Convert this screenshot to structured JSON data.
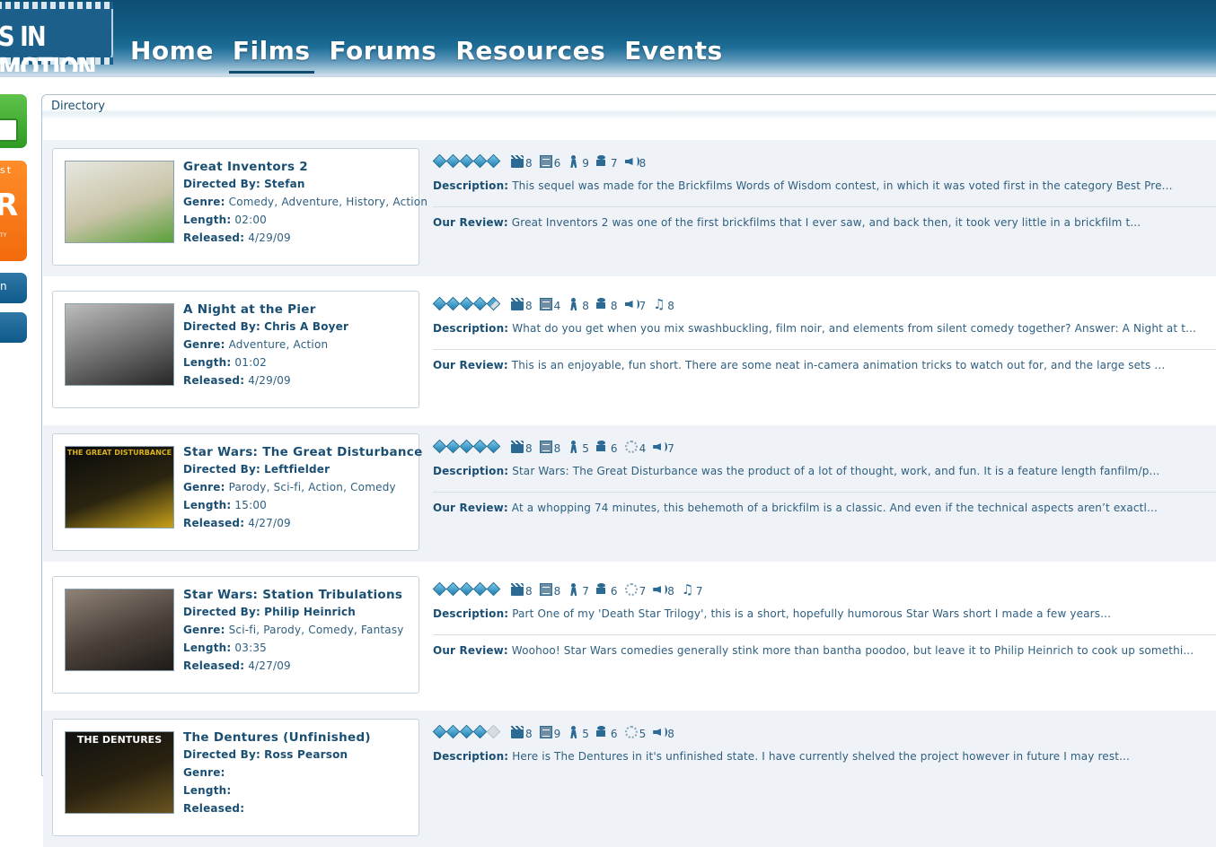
{
  "site": {
    "logo_text": "S IN MOTION"
  },
  "nav": [
    {
      "label": "Home",
      "active": false
    },
    {
      "label": "Films",
      "active": true
    },
    {
      "label": "Forums",
      "active": false
    },
    {
      "label": "Resources",
      "active": false
    },
    {
      "label": "Events",
      "active": false
    }
  ],
  "sidebar": {
    "orange_text": "st",
    "orange_big": "R",
    "orange_small": "TY",
    "blue_text": "n"
  },
  "directory": {
    "title": "Directory",
    "labels": {
      "directed_by": "Directed By:",
      "genre": "Genre:",
      "length": "Length:",
      "released": "Released:",
      "description": "Description:",
      "review": "Our Review:"
    },
    "films": [
      {
        "title": "Great Inventors 2",
        "director": "Stefan",
        "genre": "Comedy, Adventure, History, Action",
        "length": "02:00",
        "released": "4/29/09",
        "stars": [
          "full",
          "full",
          "full",
          "full",
          "full"
        ],
        "scores": [
          {
            "icon": "clapperboard-icon",
            "value": "8"
          },
          {
            "icon": "script-icon",
            "value": "6"
          },
          {
            "icon": "animation-icon",
            "value": "9"
          },
          {
            "icon": "camera-icon",
            "value": "7"
          },
          {
            "icon": "sound-icon",
            "value": "8"
          }
        ],
        "description": "This sequel was made for the Brickfilms Words of Wisdom contest, in which it was voted first in the category Best Pre...",
        "review": "Great Inventors 2 was one of the first brickfilms that I ever saw, and back then, it took very little in a brickfilm t...",
        "thumb_caption": "",
        "thumb_colors": [
          "#e7e7e0",
          "#c9c4a8",
          "#5aa03a"
        ]
      },
      {
        "title": "A Night at the Pier",
        "director": "Chris A Boyer",
        "genre": "Adventure, Action",
        "length": "01:02",
        "released": "4/29/09",
        "stars": [
          "full",
          "full",
          "full",
          "full",
          "half"
        ],
        "scores": [
          {
            "icon": "clapperboard-icon",
            "value": "8"
          },
          {
            "icon": "script-icon",
            "value": "4"
          },
          {
            "icon": "animation-icon",
            "value": "8"
          },
          {
            "icon": "camera-icon",
            "value": "8"
          },
          {
            "icon": "sound-icon",
            "value": "7"
          },
          {
            "icon": "music-icon",
            "value": "8"
          }
        ],
        "description": "What do you get when you mix swashbuckling, film noir, and elements from silent comedy together? Answer: A Night at t...",
        "review": "This is an enjoyable, fun short. There are some neat in-camera animation tricks to watch out for, and the large sets ...",
        "thumb_caption": "",
        "thumb_colors": [
          "#bdbdbd",
          "#6b6b6b",
          "#262626"
        ]
      },
      {
        "title": "Star Wars: The Great Disturbance",
        "director": "Leftfielder",
        "genre": "Parody, Sci-fi, Action, Comedy",
        "length": "15:00",
        "released": "4/27/09",
        "stars": [
          "full",
          "full",
          "full",
          "full",
          "full"
        ],
        "scores": [
          {
            "icon": "clapperboard-icon",
            "value": "8"
          },
          {
            "icon": "script-icon",
            "value": "8"
          },
          {
            "icon": "animation-icon",
            "value": "5"
          },
          {
            "icon": "camera-icon",
            "value": "6"
          },
          {
            "icon": "effects-icon",
            "value": "4"
          },
          {
            "icon": "sound-icon",
            "value": "7"
          }
        ],
        "description": "Star Wars: The Great Disturbance was the product of a lot of thought, work, and fun. It is a feature length fanfilm/p...",
        "review": "At a whopping 74 minutes, this behemoth of a brickfilm is a classic. And even if the technical aspects aren’t exactl...",
        "thumb_caption": "THE GREAT DISTURBANCE",
        "thumb_colors": [
          "#0a0a0a",
          "#2a2410",
          "#c9a21a"
        ]
      },
      {
        "title": "Star Wars: Station Tribulations",
        "director": "Philip Heinrich",
        "genre": "Sci-fi, Parody, Comedy, Fantasy",
        "length": "03:35",
        "released": "4/27/09",
        "stars": [
          "full",
          "full",
          "full",
          "full",
          "full"
        ],
        "scores": [
          {
            "icon": "clapperboard-icon",
            "value": "8"
          },
          {
            "icon": "script-icon",
            "value": "8"
          },
          {
            "icon": "animation-icon",
            "value": "7"
          },
          {
            "icon": "camera-icon",
            "value": "6"
          },
          {
            "icon": "effects-icon",
            "value": "7"
          },
          {
            "icon": "sound-icon",
            "value": "8"
          },
          {
            "icon": "music-icon",
            "value": "7"
          }
        ],
        "description": "Part One of my 'Death Star Trilogy', this is a short, hopefully humorous Star Wars short I made a few years...",
        "review": "Woohoo! Star Wars comedies generally stink more than bantha poodoo, but leave it to Philip Heinrich to cook up somethi...",
        "thumb_caption": "",
        "thumb_colors": [
          "#8f8378",
          "#4a4038",
          "#1d1a18"
        ]
      },
      {
        "title": "The Dentures (Unfinished)",
        "director": "Ross Pearson",
        "genre": "",
        "length": "",
        "released": "",
        "stars": [
          "full",
          "full",
          "full",
          "full",
          "empty"
        ],
        "scores": [
          {
            "icon": "clapperboard-icon",
            "value": "8"
          },
          {
            "icon": "script-icon",
            "value": "9"
          },
          {
            "icon": "animation-icon",
            "value": "5"
          },
          {
            "icon": "camera-icon",
            "value": "6"
          },
          {
            "icon": "effects-icon",
            "value": "5"
          },
          {
            "icon": "sound-icon",
            "value": "8"
          }
        ],
        "description": "Here is The Dentures in it's unfinished state. I have currently shelved the project however in future I may rest...",
        "review": "",
        "thumb_caption": "THE DENTURES",
        "thumb_colors": [
          "#111111",
          "#2a2210",
          "#6a5420"
        ]
      }
    ]
  }
}
